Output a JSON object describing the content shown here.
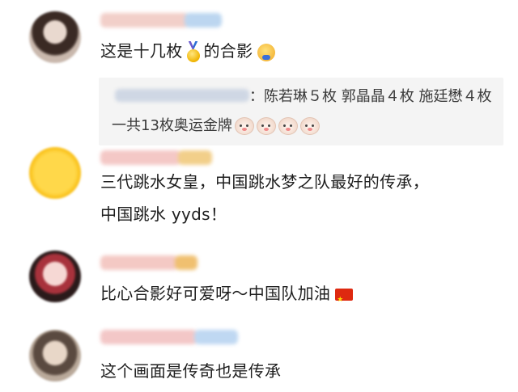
{
  "comments": [
    {
      "text": "这是十几枚",
      "text_after": "的合影",
      "emoji_medal": "gold-medal-icon",
      "emoji_face": "laughing-face-icon",
      "reply": {
        "text": "：陈若琳５枚 郭晶晶４枚 施廷懋４枚 一共13枚奥运金牌",
        "emojis": [
          "dog-face-icon",
          "dog-face-icon",
          "dog-face-icon",
          "dog-face-icon"
        ]
      }
    },
    {
      "lines": [
        "三代跳水女皇，中国跳水梦之队最好的传承，",
        "中国跳水 yyds！"
      ]
    },
    {
      "text": "比心合影好可爱呀～中国队加油",
      "emoji": "china-flag-icon"
    },
    {
      "text": "这个画面是传奇也是传承"
    }
  ],
  "colors": {
    "background": "#ffffff",
    "reply_background": "#f4f4f4",
    "text": "#1e1e1e",
    "blurred_name": "#f3c9c4"
  }
}
